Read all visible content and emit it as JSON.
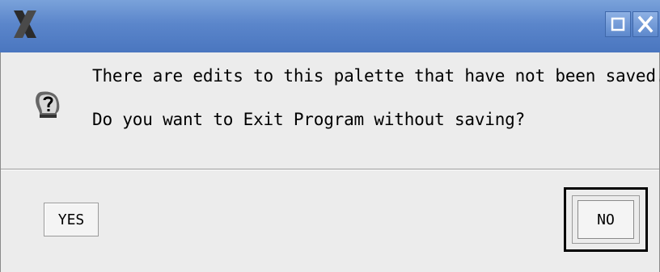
{
  "window": {
    "app_icon": "x-logo-icon",
    "titlebar_buttons": [
      "maximize-icon",
      "close-icon"
    ]
  },
  "dialog": {
    "icon": "question-head-icon",
    "message_line1": "There are edits to this palette that have not been saved.",
    "message_line2": "Do you want to Exit Program without saving?",
    "yes_label": "YES",
    "no_label": "NO"
  },
  "colors": {
    "titlebar": "#5b86cb",
    "dialog_bg": "#ececec"
  }
}
